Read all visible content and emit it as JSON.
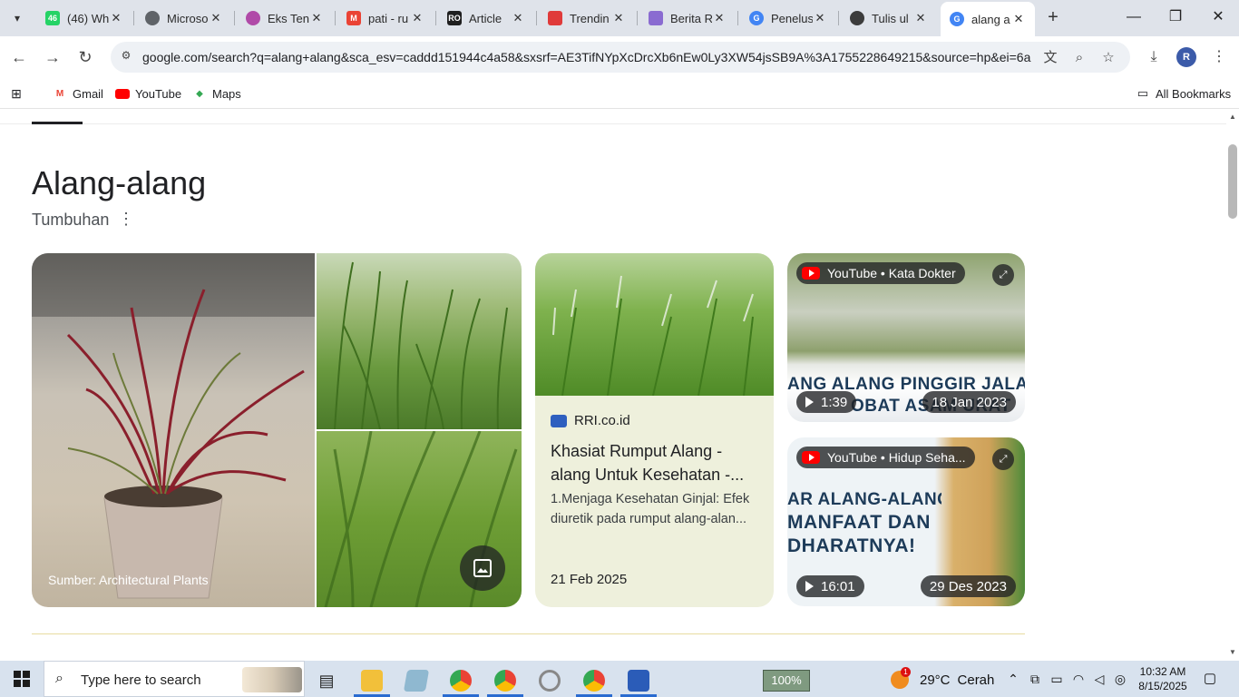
{
  "browser": {
    "tabs": [
      {
        "title": "(46) Wh",
        "fav_color": "#25d366",
        "fav_text": "46"
      },
      {
        "title": "Microso",
        "fav_color": "#5f6368",
        "fav_text": ""
      },
      {
        "title": "Eks Ten",
        "fav_color": "#b04aa8",
        "fav_text": ""
      },
      {
        "title": "pati - ru",
        "fav_color": "#ea4335",
        "fav_text": "M"
      },
      {
        "title": "Article",
        "fav_color": "#1f1f1f",
        "fav_text": "RO"
      },
      {
        "title": "Trendin",
        "fav_color": "#e03a3a",
        "fav_text": ""
      },
      {
        "title": "Berita R",
        "fav_color": "#8a6bd1",
        "fav_text": ""
      },
      {
        "title": "Penelus",
        "fav_color": "#4285f4",
        "fav_text": "G"
      },
      {
        "title": "Tulis ul",
        "fav_color": "#3c3c3c",
        "fav_text": ""
      },
      {
        "title": "alang a",
        "fav_color": "#4285f4",
        "fav_text": "G",
        "active": true
      }
    ],
    "url": "google.com/search?q=alang+alang&sca_esv=caddd151944c4a58&sxsrf=AE3TifNYpXcDrcXb6nEw0Ly3XW54jsSB9A%3A1755228649215&source=hp&ei=6a...",
    "avatar_letter": "R",
    "bookmarks": [
      {
        "label": "Gmail",
        "icon": "gmail-icon"
      },
      {
        "label": "YouTube",
        "icon": "youtube-icon"
      },
      {
        "label": "Maps",
        "icon": "maps-icon"
      }
    ],
    "all_bookmarks_label": "All Bookmarks"
  },
  "knowledge_panel": {
    "title": "Alang-alang",
    "subtitle": "Tumbuhan",
    "image_caption": "Sumber: Architectural Plants",
    "article": {
      "source": "RRI.co.id",
      "title": "Khasiat Rumput Alang - alang Untuk Kesehatan -...",
      "snippet": "1.Menjaga Kesehatan Ginjal: Efek diuretik pada rumput alang-alan...",
      "date": "21 Feb 2025"
    },
    "videos": [
      {
        "channel": "YouTube • Kata Dokter",
        "duration": "1:39",
        "date": "18 Jan 2023",
        "thumb_text_1": "ANG ALANG PINGGIR JALAN",
        "thumb_text_2": "OBAT ASAM URAT"
      },
      {
        "channel": "YouTube • Hidup Seha...",
        "duration": "16:01",
        "date": "29 Des 2023",
        "thumb_text_1": "AR ALANG-ALANG,",
        "thumb_text_2": "MANFAAT DAN",
        "thumb_text_3": "DHARATNYA!"
      }
    ]
  },
  "taskbar": {
    "search_placeholder": "Type here to search",
    "zoom": "100%",
    "temperature": "29°C",
    "weather": "Cerah",
    "weather_badge": "1",
    "time": "10:32 AM",
    "date": "8/15/2025"
  }
}
